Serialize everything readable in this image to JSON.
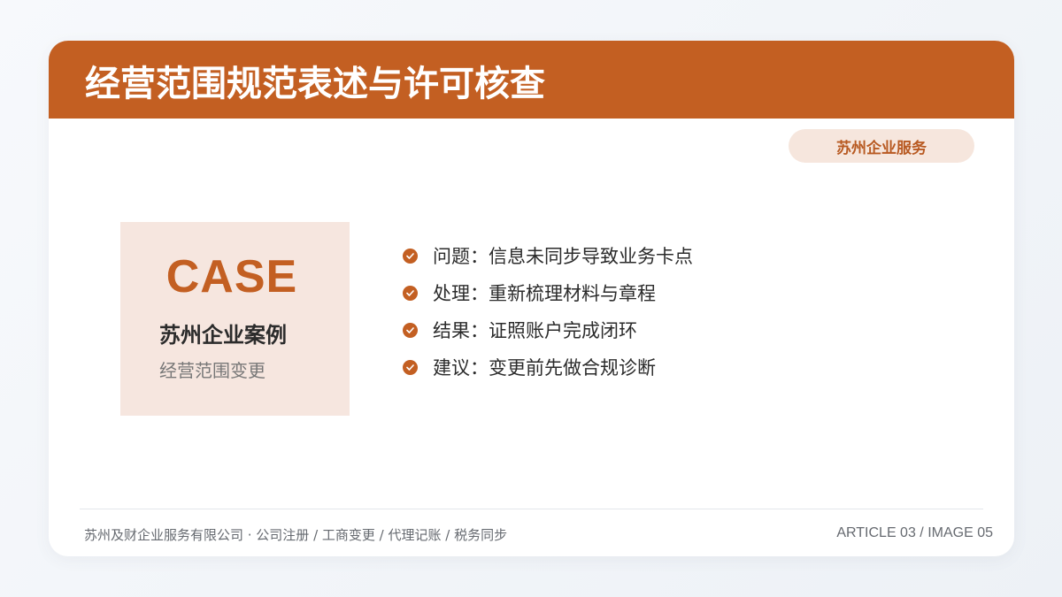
{
  "header": {
    "title": "经营范围规范表述与许可核查"
  },
  "badge": {
    "label": "苏州企业服务"
  },
  "case": {
    "word": "CASE",
    "title": "苏州企业案例",
    "subtitle": "经营范围变更"
  },
  "bullets": [
    {
      "text": "问题：信息未同步导致业务卡点",
      "icon": "check-circle-icon"
    },
    {
      "text": "处理：重新梳理材料与章程",
      "icon": "check-circle-icon"
    },
    {
      "text": "结果：证照账户完成闭环",
      "icon": "check-circle-icon"
    },
    {
      "text": "建议：变更前先做合规诊断",
      "icon": "check-circle-icon"
    }
  ],
  "footer": {
    "left": "苏州及财企业服务有限公司 · 公司注册 / 工商变更 / 代理记账 / 税务同步",
    "right": "ARTICLE 03 / IMAGE 05"
  },
  "colors": {
    "accent": "#c35f22",
    "badge_bg": "#f6e6dd",
    "case_bg": "#f6e6df"
  }
}
